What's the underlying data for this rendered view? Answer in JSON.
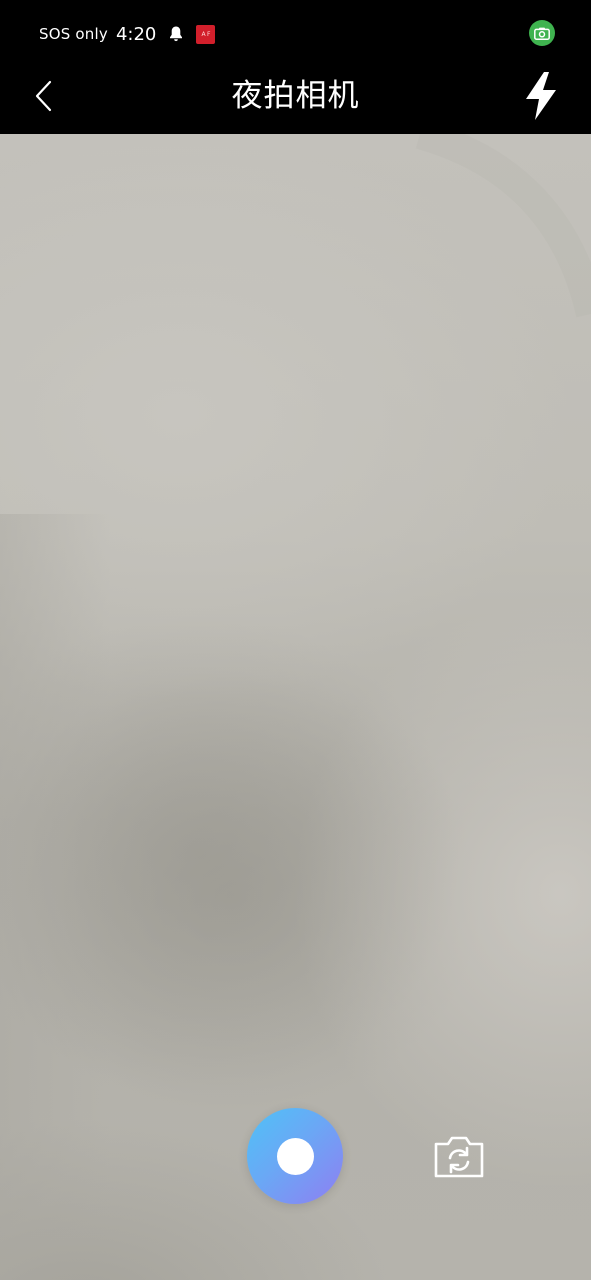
{
  "status_bar": {
    "carrier_text": "SOS only",
    "time": "4:20",
    "icons": [
      "bell-icon",
      "app-badge-icon",
      "camera-indicator-icon"
    ],
    "app_badge_text": "A F"
  },
  "title_bar": {
    "title": "夜拍相机",
    "back_icon": "chevron-left-icon",
    "flash_icon": "lightning-icon"
  },
  "controls": {
    "shutter_icon": "shutter-icon",
    "switch_camera_icon": "camera-switch-icon"
  },
  "colors": {
    "background": "#000000",
    "shutter_gradient_start": "#4fc2f7",
    "shutter_gradient_end": "#8f7ef2",
    "camera_indicator": "#3fb34f",
    "app_badge": "#d21f2b"
  }
}
